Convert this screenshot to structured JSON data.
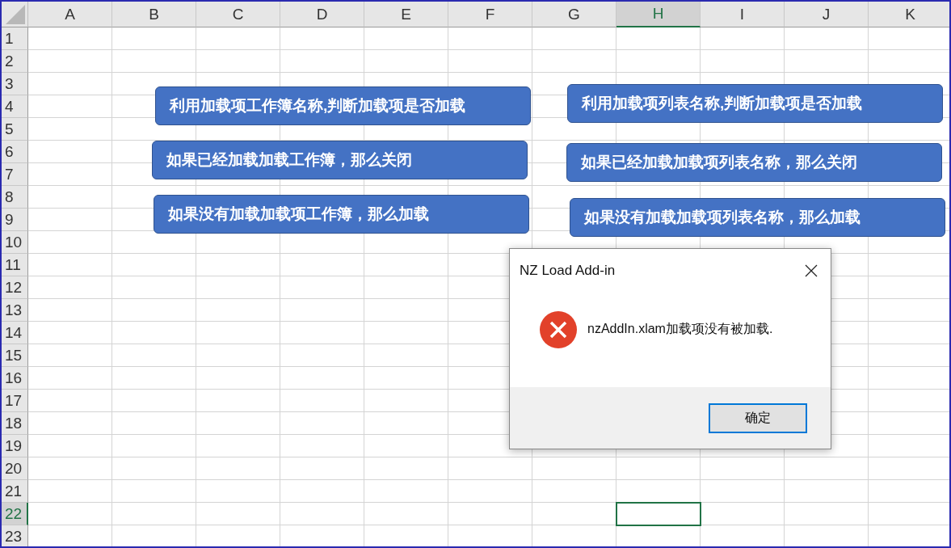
{
  "sheet": {
    "columns": [
      {
        "label": "A",
        "selected": false
      },
      {
        "label": "B",
        "selected": false
      },
      {
        "label": "C",
        "selected": false
      },
      {
        "label": "D",
        "selected": false
      },
      {
        "label": "E",
        "selected": false
      },
      {
        "label": "F",
        "selected": false
      },
      {
        "label": "G",
        "selected": false
      },
      {
        "label": "H",
        "selected": true
      },
      {
        "label": "I",
        "selected": false
      },
      {
        "label": "J",
        "selected": false
      },
      {
        "label": "K",
        "selected": false
      }
    ],
    "rows": [
      {
        "label": "1",
        "selected": false
      },
      {
        "label": "2",
        "selected": false
      },
      {
        "label": "3",
        "selected": false
      },
      {
        "label": "4",
        "selected": false
      },
      {
        "label": "5",
        "selected": false
      },
      {
        "label": "6",
        "selected": false
      },
      {
        "label": "7",
        "selected": false
      },
      {
        "label": "8",
        "selected": false
      },
      {
        "label": "9",
        "selected": false
      },
      {
        "label": "10",
        "selected": false
      },
      {
        "label": "11",
        "selected": false
      },
      {
        "label": "12",
        "selected": false
      },
      {
        "label": "13",
        "selected": false
      },
      {
        "label": "14",
        "selected": false
      },
      {
        "label": "15",
        "selected": false
      },
      {
        "label": "16",
        "selected": false
      },
      {
        "label": "17",
        "selected": false
      },
      {
        "label": "18",
        "selected": false
      },
      {
        "label": "19",
        "selected": false
      },
      {
        "label": "20",
        "selected": false
      },
      {
        "label": "21",
        "selected": false
      },
      {
        "label": "22",
        "selected": true
      },
      {
        "label": "23",
        "selected": false
      }
    ]
  },
  "shapes": [
    {
      "label": "利用加载项工作簿名称,判断加载项是否加载"
    },
    {
      "label": "利用加载项列表名称,判断加载项是否加载"
    },
    {
      "label": "如果已经加载加载工作簿，那么关闭"
    },
    {
      "label": "如果已经加载加载项列表名称，那么关闭"
    },
    {
      "label": "如果没有加载加载项工作簿，那么加载"
    },
    {
      "label": "如果没有加载加载项列表名称，那么加载"
    }
  ],
  "dialog": {
    "title": "NZ Load Add-in",
    "message": "nzAddIn.xlam加载项没有被加载.",
    "buttons": [
      "确定"
    ]
  }
}
